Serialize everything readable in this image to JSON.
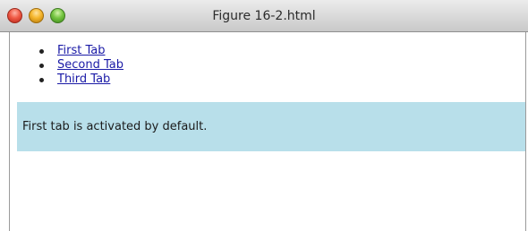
{
  "window": {
    "title": "Figure 16-2.html"
  },
  "tabs": [
    {
      "label": "First Tab"
    },
    {
      "label": "Second Tab"
    },
    {
      "label": "Third Tab"
    }
  ],
  "panel": {
    "text": "First tab is activated by default."
  },
  "colors": {
    "panel_background": "#b8dfea",
    "link": "#1a1aa6"
  }
}
